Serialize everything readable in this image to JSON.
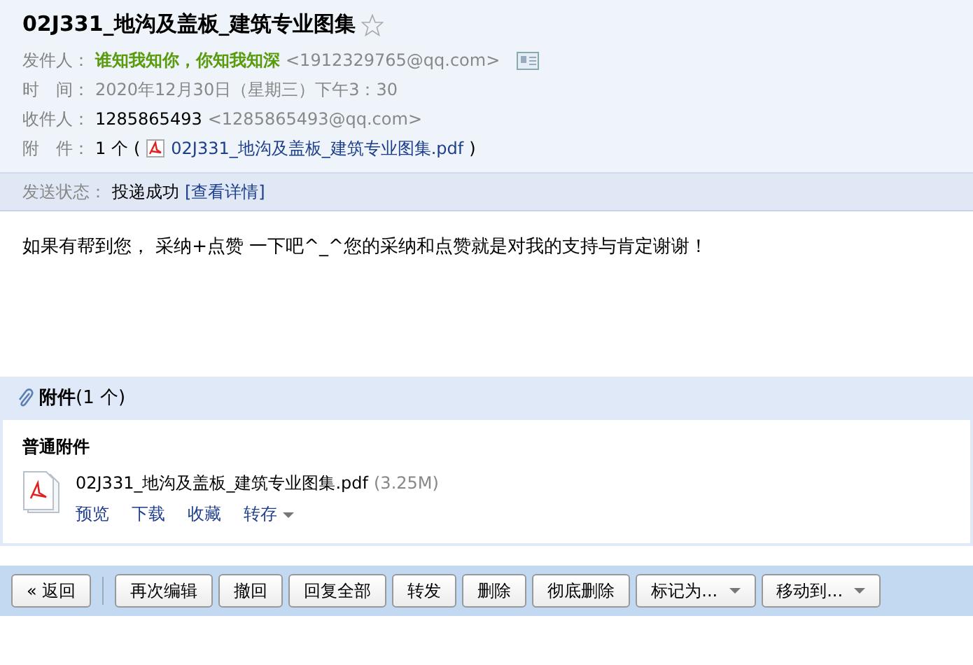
{
  "subject": {
    "title": "02J331_地沟及盖板_建筑专业图集",
    "starred": false
  },
  "header_fields": [
    {
      "kind": "sender",
      "label": "发件人：",
      "name": "谁知我知你，你知我知深",
      "address": "<1912329765@qq.com>"
    },
    {
      "kind": "text",
      "label": "时　间：",
      "value": "2020年12月30日（星期三）下午3：30"
    },
    {
      "kind": "recipient",
      "label": "收件人：",
      "name": "1285865493",
      "address": "<1285865493@qq.com>"
    },
    {
      "kind": "attachment",
      "label": "附　件：",
      "count": "1 个",
      "open": "(",
      "file": "02J331_地沟及盖板_建筑专业图集.pdf",
      "close": ")"
    }
  ],
  "send_status": {
    "label": "发送状态：",
    "value": "投递成功",
    "link": "[查看详情]"
  },
  "body": "如果有帮到您， 采纳+点赞 一下吧^_^您的采纳和点赞就是对我的支持与肯定谢谢！",
  "attachments": {
    "title": "附件",
    "count": "(1 个)",
    "group": "普通附件",
    "files": [
      {
        "name": "02J331_地沟及盖板_建筑专业图集.pdf",
        "size": "(3.25M)",
        "actions": [
          {
            "label": "预览",
            "kind": "link"
          },
          {
            "label": "下载",
            "kind": "link"
          },
          {
            "label": "收藏",
            "kind": "link"
          },
          {
            "label": "转存",
            "kind": "dropdown"
          }
        ]
      }
    ]
  },
  "toolbar": [
    {
      "label": "« 返回",
      "kind": "button"
    },
    {
      "kind": "separator"
    },
    {
      "label": "再次编辑",
      "kind": "button"
    },
    {
      "label": "撤回",
      "kind": "button"
    },
    {
      "label": "回复全部",
      "kind": "button"
    },
    {
      "label": "转发",
      "kind": "button"
    },
    {
      "label": "删除",
      "kind": "button"
    },
    {
      "label": "彻底删除",
      "kind": "button"
    },
    {
      "label": "标记为...",
      "kind": "dropdown"
    },
    {
      "label": "移动到...",
      "kind": "dropdown"
    }
  ]
}
